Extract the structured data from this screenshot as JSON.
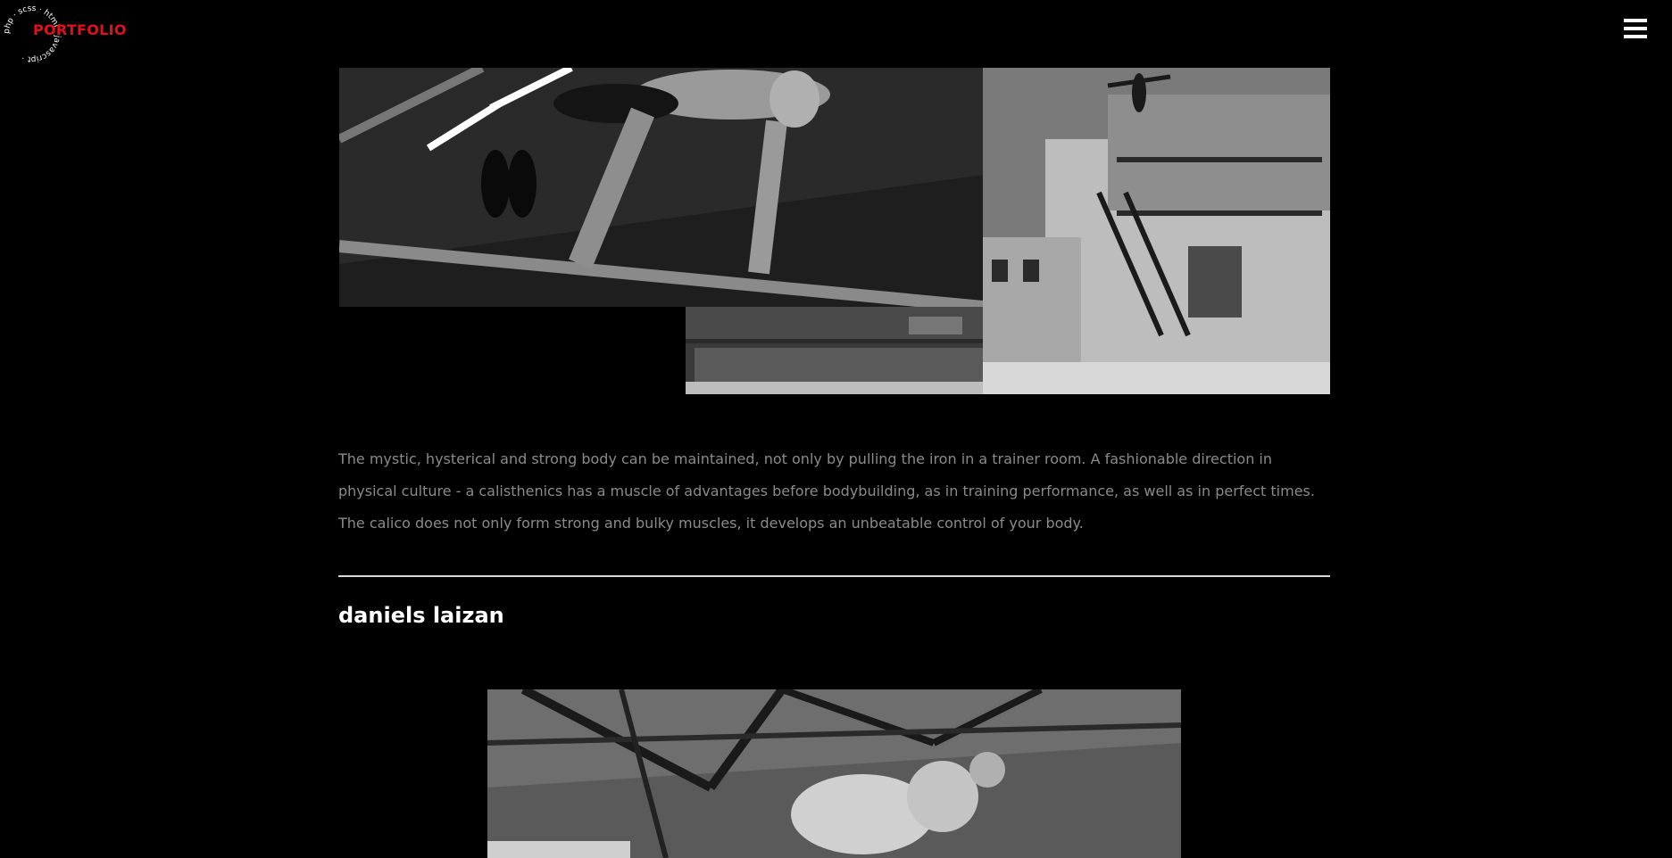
{
  "header": {
    "logo_ring_text": "php · scss · html · javascript ·",
    "logo_label": "PORTFOLIO",
    "logo_color": "#e0111b",
    "menu_icon": "hamburger-menu-icon"
  },
  "gallery": {
    "images": [
      {
        "name": "calisthenics-bar-photo",
        "content": "black and white photo of an athlete leaning over a horizontal bar in a gym"
      },
      {
        "name": "building-handstand-photo",
        "content": "black and white photo of a person doing a handstand on a building roof"
      },
      {
        "name": "pool-photo",
        "content": "black and white photo of an empty pool area"
      }
    ]
  },
  "article": {
    "description": "The mystic, hysterical and strong body can be maintained, not only by pulling the iron in a trainer room. A fashionable direction in physical culture - a calisthenics has a muscle of advantages before bodybuilding, as in training performance, as well as in perfect times. The calico does not only form strong and bulky muscles, it develops an unbeatable control of your body.",
    "author": "daniels laizan"
  },
  "colors": {
    "background": "#000000",
    "text_muted": "#8a8a8a",
    "divider": "#d8d8d8",
    "heading": "#ffffff"
  }
}
